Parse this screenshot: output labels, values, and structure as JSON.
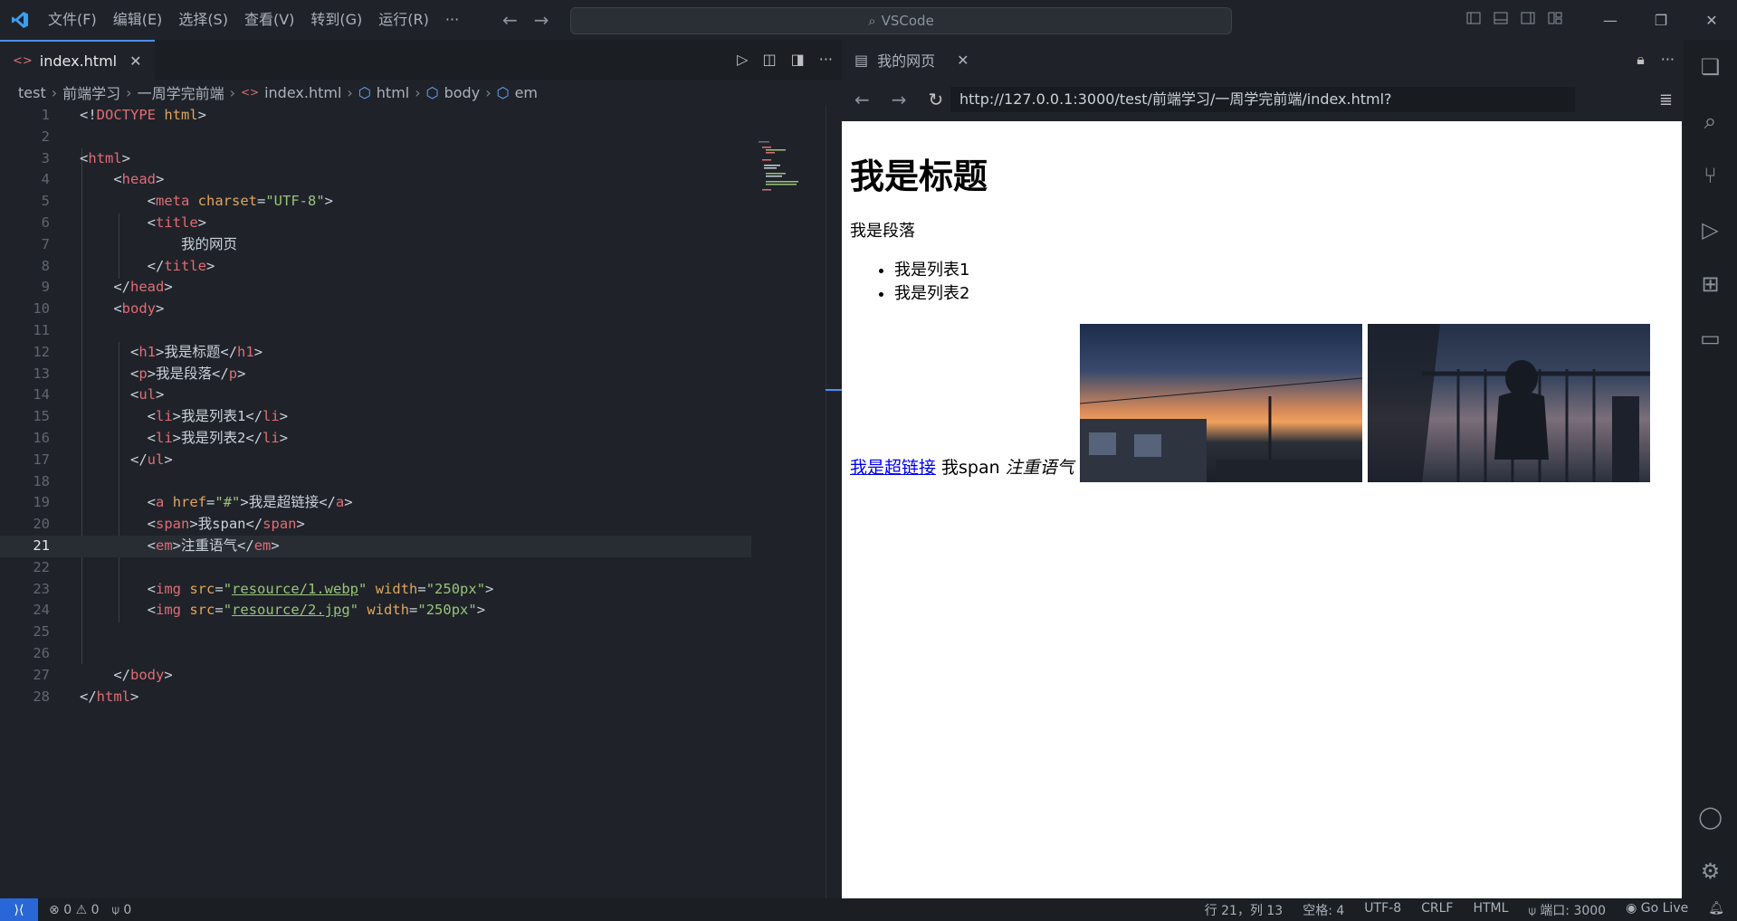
{
  "menu": [
    "文件(F)",
    "编辑(E)",
    "选择(S)",
    "查看(V)",
    "转到(G)",
    "运行(R)",
    "···"
  ],
  "command_center": {
    "placeholder": "VSCode"
  },
  "editor": {
    "tab_label": "index.html",
    "breadcrumb": [
      "test",
      "前端学习",
      "一周学完前端",
      "index.html",
      "html",
      "body",
      "em"
    ],
    "active_line": 21
  },
  "preview": {
    "tab_label": "我的网页",
    "url": "http://127.0.0.1:3000/test/前端学习/一周学完前端/index.html?",
    "h1": "我是标题",
    "paragraph": "我是段落",
    "list": [
      "我是列表1",
      "我是列表2"
    ],
    "link": "我是超链接",
    "span": "我span",
    "em": "注重语气"
  },
  "status": {
    "errors": "0",
    "warnings": "0",
    "ports_signal": "0",
    "position": "行 21，列 13",
    "spaces": "空格: 4",
    "encoding": "UTF-8",
    "eol": "CRLF",
    "language": "HTML",
    "port": "端口: 3000",
    "golive": "Go Live"
  },
  "colors": {
    "accent": "#2a67d6",
    "tab_active_border": "#4c8dff"
  }
}
